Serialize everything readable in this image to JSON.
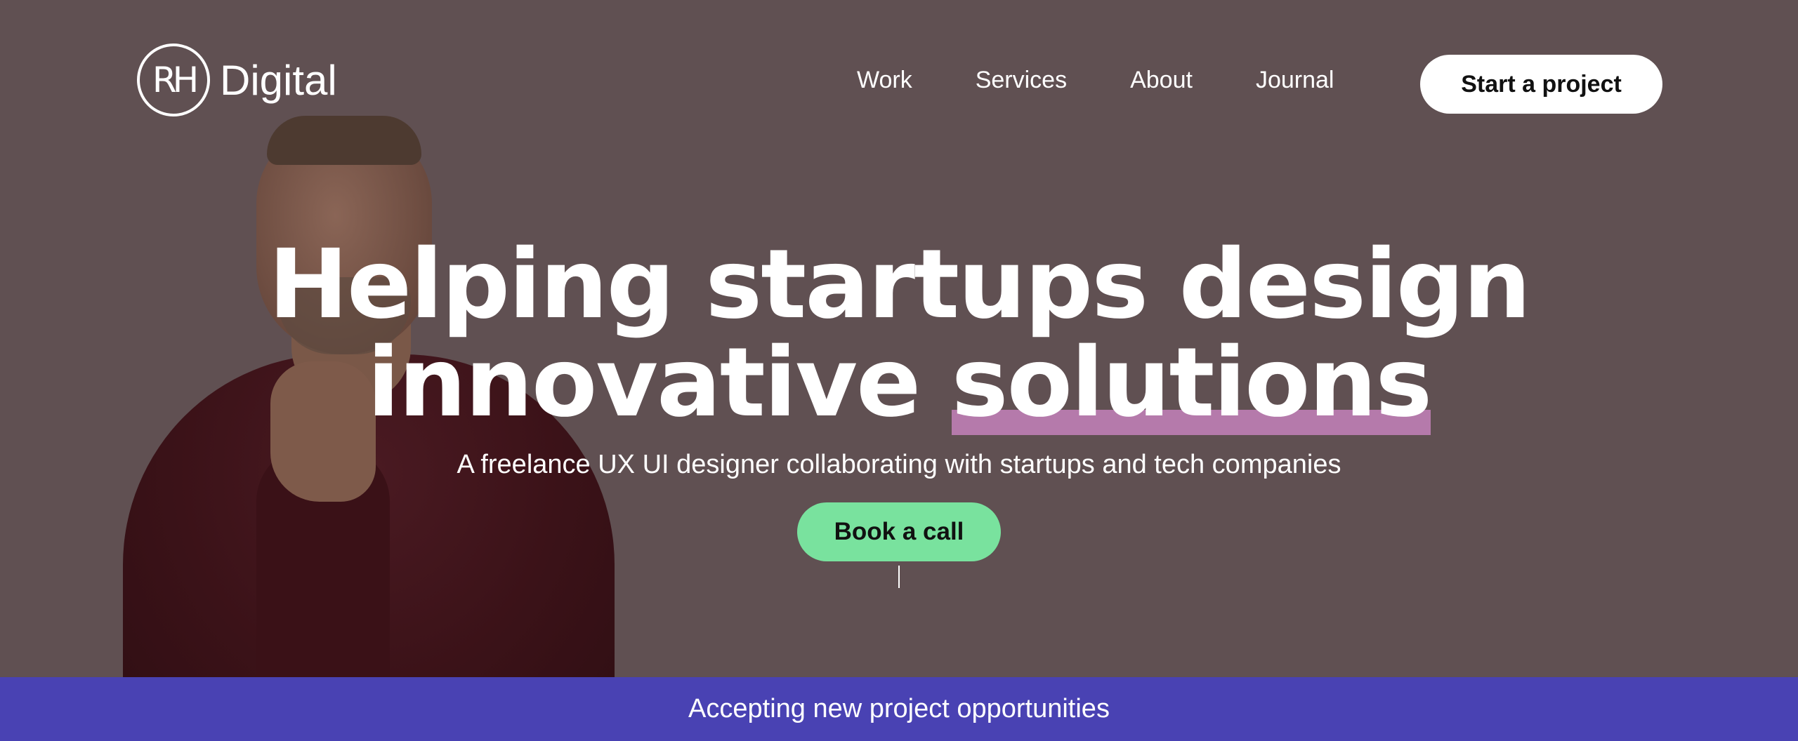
{
  "brand": {
    "mark": "RH",
    "name": "Digital"
  },
  "nav": {
    "items": [
      "Work",
      "Services",
      "About",
      "Journal"
    ],
    "cta_label": "Start a project"
  },
  "hero": {
    "headline_line1": "Helping startups design",
    "headline_line2_plain": "innovative ",
    "headline_line2_highlight": "solutions",
    "subheadline": "A freelance UX UI designer collaborating with startups and tech companies",
    "cta_label": "Book a call"
  },
  "banner": {
    "text": "Accepting new project opportunities"
  },
  "colors": {
    "background": "#605052",
    "highlight": "#b57aab",
    "cta_green": "#79e29e",
    "banner": "#4942b3",
    "text": "#ffffff"
  }
}
